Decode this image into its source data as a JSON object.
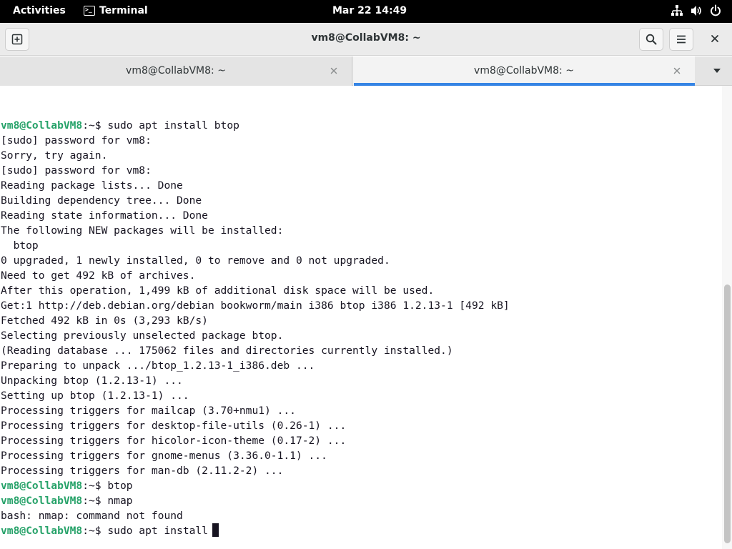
{
  "topbar": {
    "activities": "Activities",
    "app_name": "Terminal",
    "clock": "Mar 22  14:49",
    "icons": [
      "network-icon",
      "volume-icon",
      "power-icon"
    ]
  },
  "window": {
    "title": "vm8@CollabVM8: ~",
    "new_tab_icon": "new-tab-icon",
    "search_icon": "search-icon",
    "menu_icon": "hamburger-menu-icon",
    "close_icon": "close-icon"
  },
  "tabs": [
    {
      "label": "vm8@CollabVM8: ~",
      "active": false
    },
    {
      "label": "vm8@CollabVM8: ~",
      "active": true
    }
  ],
  "colors": {
    "prompt": "#26a269",
    "accent": "#3584e4",
    "text": "#171421"
  },
  "terminal": {
    "lines": [
      {
        "user": "vm8@CollabVM8",
        "rest": ":~$ sudo apt install btop"
      },
      {
        "text": "[sudo] password for vm8:"
      },
      {
        "text": "Sorry, try again."
      },
      {
        "text": "[sudo] password for vm8:"
      },
      {
        "text": "Reading package lists... Done"
      },
      {
        "text": "Building dependency tree... Done"
      },
      {
        "text": "Reading state information... Done"
      },
      {
        "text": "The following NEW packages will be installed:"
      },
      {
        "text": "  btop"
      },
      {
        "text": "0 upgraded, 1 newly installed, 0 to remove and 0 not upgraded."
      },
      {
        "text": "Need to get 492 kB of archives."
      },
      {
        "text": "After this operation, 1,499 kB of additional disk space will be used."
      },
      {
        "text": "Get:1 http://deb.debian.org/debian bookworm/main i386 btop i386 1.2.13-1 [492 kB]"
      },
      {
        "text": "Fetched 492 kB in 0s (3,293 kB/s)"
      },
      {
        "text": "Selecting previously unselected package btop."
      },
      {
        "text": "(Reading database ... 175062 files and directories currently installed.)"
      },
      {
        "text": "Preparing to unpack .../btop_1.2.13-1_i386.deb ..."
      },
      {
        "text": "Unpacking btop (1.2.13-1) ..."
      },
      {
        "text": "Setting up btop (1.2.13-1) ..."
      },
      {
        "text": "Processing triggers for mailcap (3.70+nmu1) ..."
      },
      {
        "text": "Processing triggers for desktop-file-utils (0.26-1) ..."
      },
      {
        "text": "Processing triggers for hicolor-icon-theme (0.17-2) ..."
      },
      {
        "text": "Processing triggers for gnome-menus (3.36.0-1.1) ..."
      },
      {
        "text": "Processing triggers for man-db (2.11.2-2) ..."
      },
      {
        "user": "vm8@CollabVM8",
        "rest": ":~$ btop"
      },
      {
        "user": "vm8@CollabVM8",
        "rest": ":~$ nmap"
      },
      {
        "text": "bash: nmap: command not found"
      },
      {
        "user": "vm8@CollabVM8",
        "rest": ":~$ sudo apt install",
        "cursor": true
      }
    ]
  }
}
